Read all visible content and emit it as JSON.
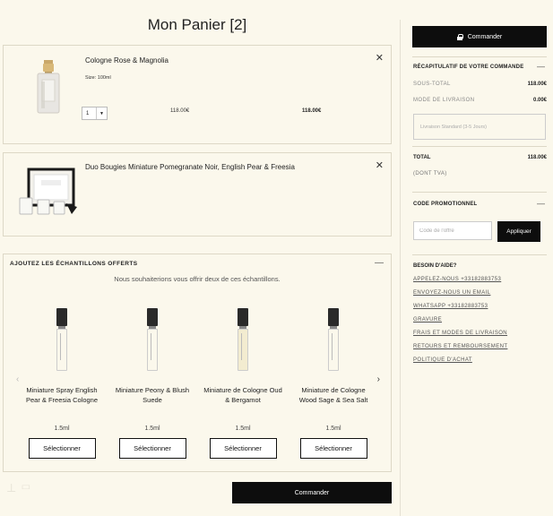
{
  "cart": {
    "title": "Mon Panier [2]",
    "items": [
      {
        "name": "Cologne Rose & Magnolia",
        "size": "Size: 100ml",
        "quantity": "1",
        "unit_price": "118.00€",
        "line_total": "118.00€"
      },
      {
        "name": "Duo Bougies Miniature Pomegranate Noir, English Pear & Freesia"
      }
    ]
  },
  "samples": {
    "title": "AJOUTEZ LES ÉCHANTILLONS OFFERTS",
    "subtitle": "Nous souhaiterions vous offrir deux de ces échantillons.",
    "items": [
      {
        "name": "Miniature Spray English Pear & Freesia Cologne",
        "size": "1.5ml",
        "button": "Sélectionner"
      },
      {
        "name": "Miniature Peony & Blush Suede",
        "size": "1.5ml",
        "button": "Sélectionner"
      },
      {
        "name": "Miniature de Cologne Oud & Bergamot",
        "size": "1.5ml",
        "button": "Sélectionner"
      },
      {
        "name": "Miniature de Cologne Wood Sage & Sea Salt",
        "size": "1.5ml",
        "button": "Sélectionner"
      }
    ]
  },
  "checkout_label": "Commander",
  "summary": {
    "title": "RÉCAPITULATIF DE VOTRE COMMANDE",
    "subtotal_label": "SOUS-TOTAL",
    "subtotal_value": "118.00€",
    "shipping_label": "MODE DE LIVRAISON",
    "shipping_value": "0.00€",
    "shipping_option": "Livraison Standard (3-5 Jours)",
    "total_label": "TOTAL",
    "total_value": "118.00€",
    "tax_note": "(DONT TVA)"
  },
  "promo": {
    "title": "CODE PROMOTIONNEL",
    "placeholder": "Code de l'offre",
    "button": "Appliquer"
  },
  "help": {
    "title": "BESOIN D'AIDE?",
    "links": [
      "APPELEZ-NOUS +33182883753",
      "ENVOYEZ-NOUS UN EMAIL",
      "WHATSAPP +33182883753",
      "GRAVURE",
      "FRAIS ET MODES DE LIVRAISON",
      "RETOURS ET REMBOURSEMENT",
      "POLITIQUE D'ACHAT"
    ]
  }
}
